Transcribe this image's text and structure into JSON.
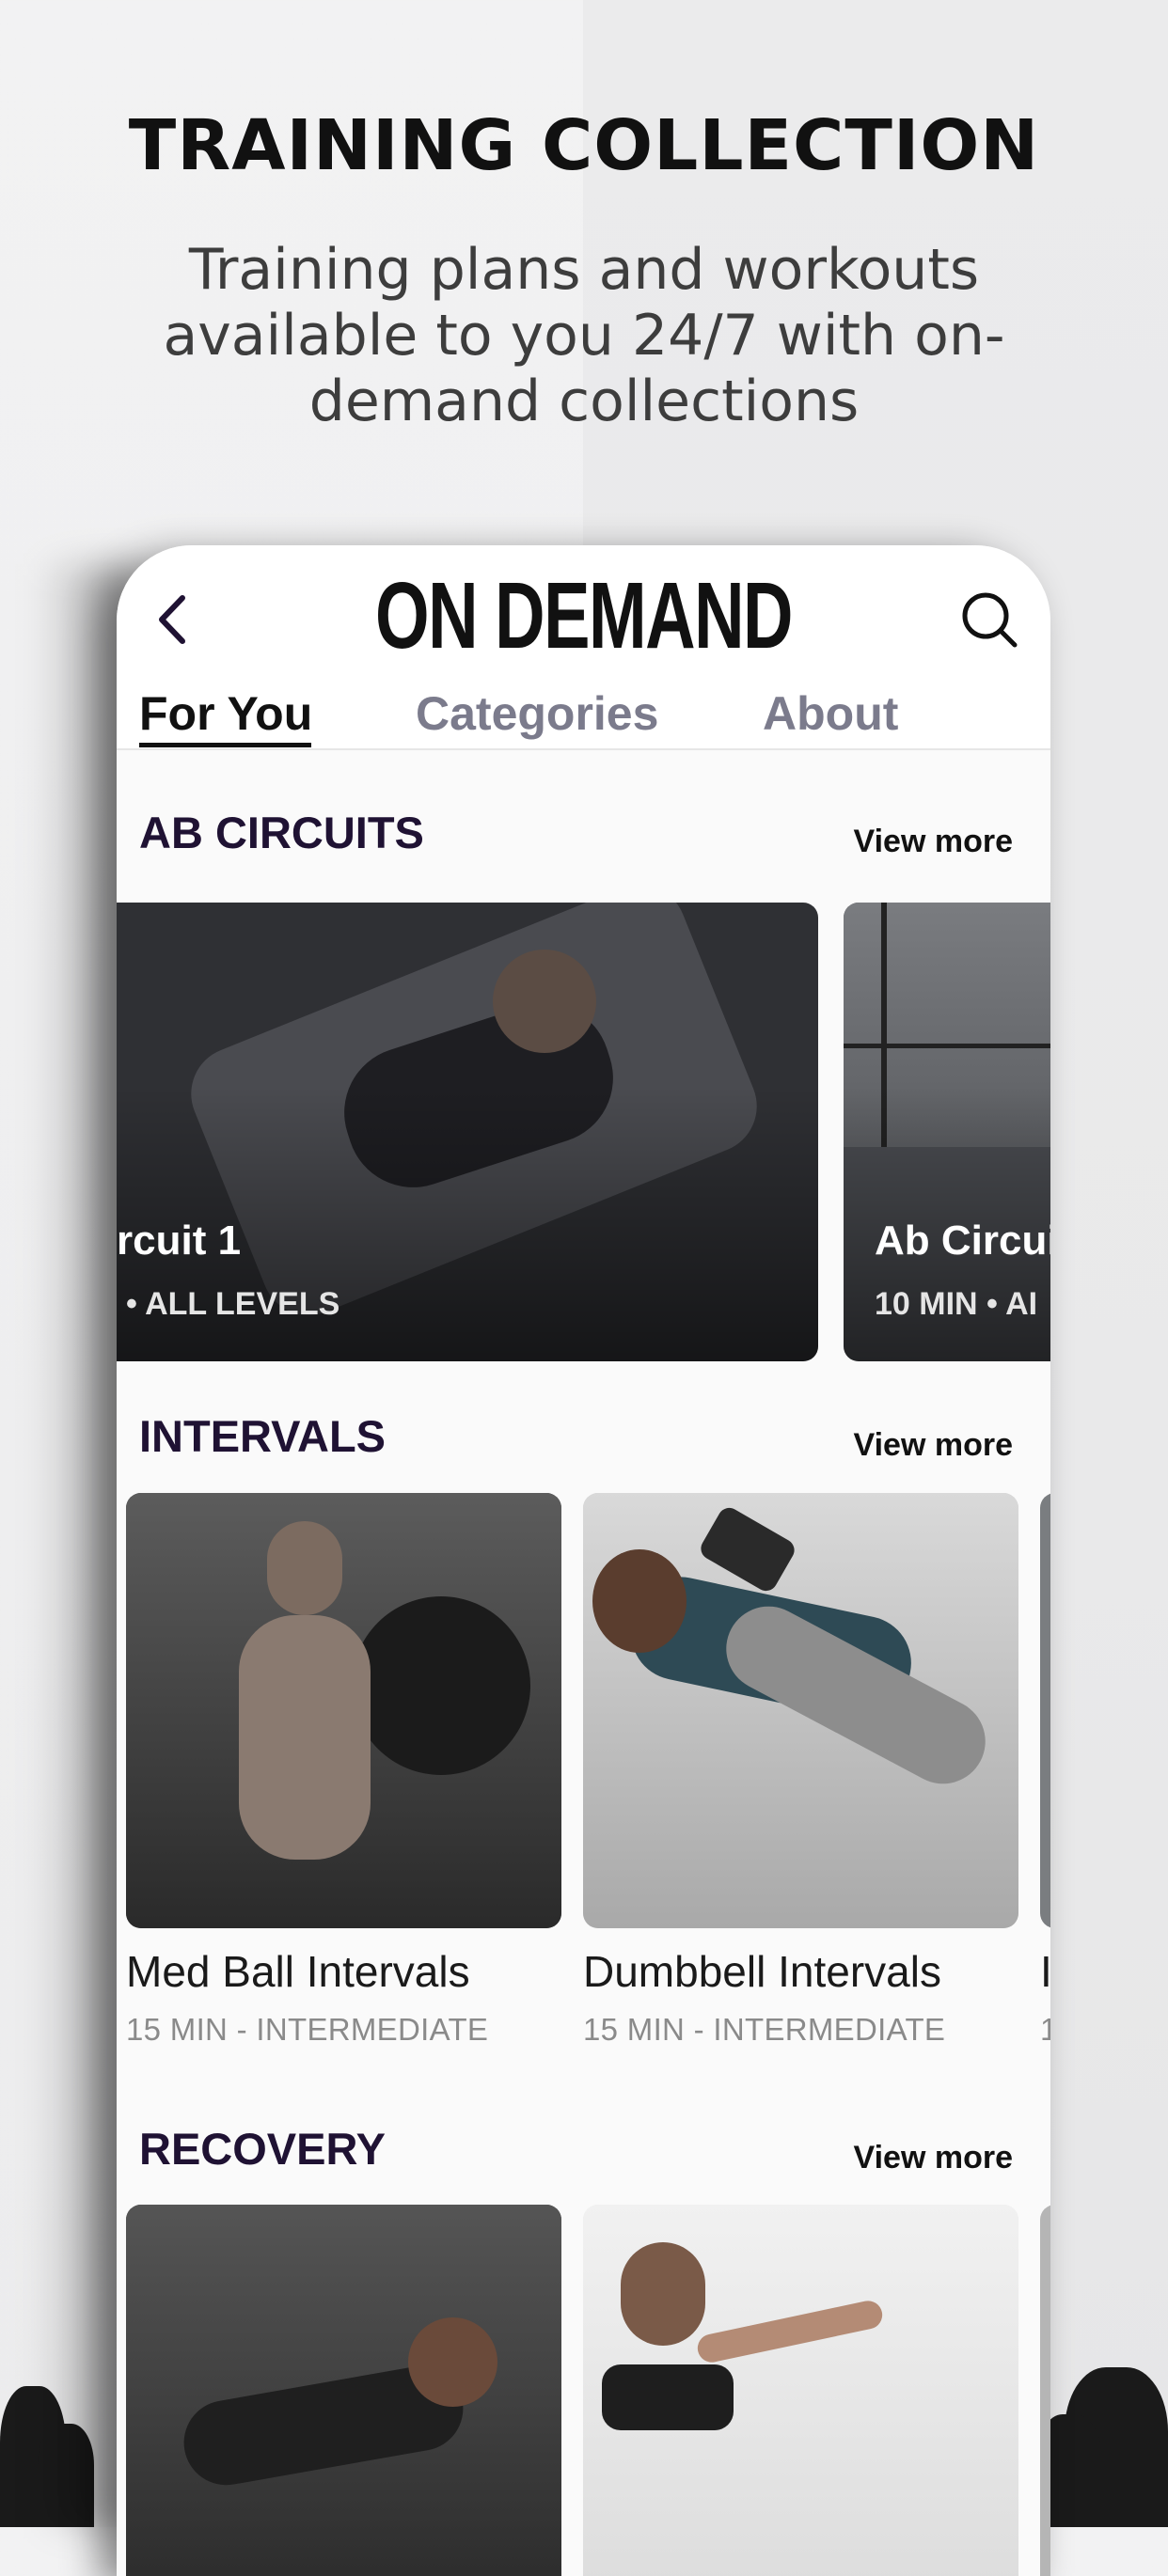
{
  "promo": {
    "headline": "TRAINING COLLECTION",
    "subhead": "Training plans and workouts available to you 24/7 with on-demand collections"
  },
  "app": {
    "title": "ON DEMAND",
    "tabs": [
      {
        "label": "For You",
        "active": true
      },
      {
        "label": "Categories",
        "active": false
      },
      {
        "label": "About",
        "active": false
      }
    ]
  },
  "sections": [
    {
      "title": "AB CIRCUITS",
      "view_more": "View more",
      "cards": [
        {
          "title": "rcuit 1",
          "meta": "• ALL LEVELS"
        },
        {
          "title": "Ab Circui",
          "meta": "10 MIN • AI"
        }
      ]
    },
    {
      "title": "INTERVALS",
      "view_more": "View more",
      "items": [
        {
          "title": "Med Ball Intervals",
          "meta": "15 MIN - INTERMEDIATE"
        },
        {
          "title": "Dumbbell Intervals",
          "meta": "15 MIN - INTERMEDIATE"
        },
        {
          "title": "I",
          "meta": "1"
        }
      ]
    },
    {
      "title": "RECOVERY",
      "view_more": "View more"
    }
  ],
  "icons": {
    "back": "chevron-left-icon",
    "search": "search-icon"
  },
  "colors": {
    "section_title": "#1f1233",
    "tab_inactive": "#7b7b8c"
  }
}
